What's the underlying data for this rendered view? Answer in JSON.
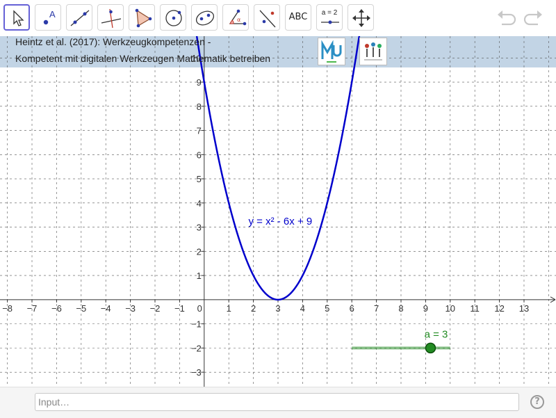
{
  "toolbar": {
    "text_tool_label": "ABC",
    "slider_tool_label": "a = 2",
    "tools": [
      {
        "name": "move-tool"
      },
      {
        "name": "point-tool"
      },
      {
        "name": "line-tool"
      },
      {
        "name": "perpendicular-line-tool"
      },
      {
        "name": "polygon-tool"
      },
      {
        "name": "circle-center-point-tool"
      },
      {
        "name": "conic-tool"
      },
      {
        "name": "angle-tool"
      },
      {
        "name": "reflect-tool"
      },
      {
        "name": "text-tool"
      },
      {
        "name": "slider-tool"
      },
      {
        "name": "move-graphics-view-tool"
      }
    ]
  },
  "reference": {
    "line1": "Heintz et al. (2017): Werkzeugkompetenzen -",
    "line2": "Kompetent mit digitalen Werkzeugen Mathematik betreiben"
  },
  "chart_data": {
    "type": "line",
    "x_ticks": [
      "−8",
      "−7",
      "−6",
      "−5",
      "−4",
      "−3",
      "−2",
      "−1",
      "0",
      "1",
      "2",
      "3",
      "4",
      "5",
      "6",
      "7",
      "8",
      "9",
      "10",
      "11",
      "12",
      "13"
    ],
    "y_ticks": [
      "−3",
      "−2",
      "−1",
      "1",
      "2",
      "3",
      "4",
      "5",
      "6",
      "7",
      "8",
      "9",
      "10"
    ],
    "xlim": [
      -8.3,
      14.3
    ],
    "ylim": [
      -3.6,
      10.9
    ],
    "grid": true,
    "function_label": "y = x² - 6x + 9",
    "curve": {
      "a": 1,
      "b": -6,
      "c": 9
    },
    "slider": {
      "label": "a = 3",
      "value": 3,
      "min": 6,
      "max": 10,
      "knob_x": 9.2,
      "y": -2
    }
  },
  "colors": {
    "curve": "#0000cc",
    "slider": "#228b22",
    "accent": "#6561d6",
    "header": "#b7cde0"
  },
  "input_bar": {
    "placeholder": "Input…",
    "help": "?"
  }
}
